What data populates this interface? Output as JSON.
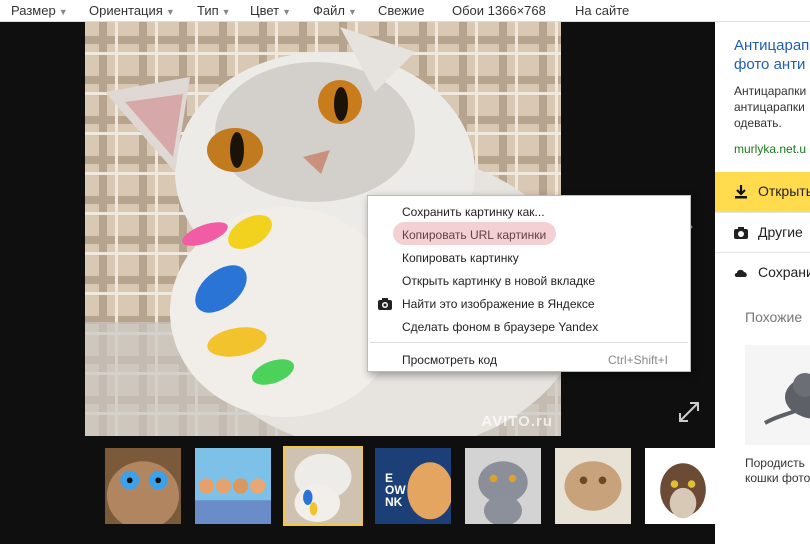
{
  "filters": [
    {
      "label": "Размер",
      "dropdown": true
    },
    {
      "label": "Ориентация",
      "dropdown": true
    },
    {
      "label": "Тип",
      "dropdown": true
    },
    {
      "label": "Цвет",
      "dropdown": true
    },
    {
      "label": "Файл",
      "dropdown": true
    },
    {
      "label": "Свежие",
      "dropdown": false
    },
    {
      "label": "Обои 1366×768",
      "dropdown": false
    },
    {
      "label": "На сайте",
      "dropdown": false
    }
  ],
  "viewer": {
    "watermark": "AVITO.ru"
  },
  "context_menu": {
    "items": [
      {
        "label": "Сохранить картинку как...",
        "icon": ""
      },
      {
        "label": "Копировать URL картинки",
        "icon": "",
        "highlighted": true
      },
      {
        "label": "Копировать картинку",
        "icon": ""
      },
      {
        "label": "Открыть картинку в новой вкладке",
        "icon": ""
      },
      {
        "label": "Найти это изображение в Яндексе",
        "icon": "camera-search-icon"
      },
      {
        "label": "Сделать фоном в браузере Yandex",
        "icon": ""
      },
      {
        "label": "Просмотреть код",
        "icon": "",
        "shortcut": "Ctrl+Shift+I"
      }
    ]
  },
  "thumbnails": [
    {
      "name": "blue-eyed-kitten",
      "label": ""
    },
    {
      "name": "kittens-row",
      "label": ""
    },
    {
      "name": "cat-colored-claws",
      "label": "",
      "active": true
    },
    {
      "name": "kitten-bow",
      "label": "E\nOW\nNK"
    },
    {
      "name": "grey-british-cat",
      "label": ""
    },
    {
      "name": "cat-with-toy",
      "label": ""
    },
    {
      "name": "siamese-cat",
      "label": ""
    }
  ],
  "sidepanel": {
    "ad_title_line1": "Антицарапки",
    "ad_title_line2": "фото анти",
    "ad_text_line1": "Антицарапки",
    "ad_text_line2": "антицарапки",
    "ad_text_line3": "одевать.",
    "ad_url": "murlyka.net.u",
    "open_button": "Открыть",
    "other_sizes_button": "Другие",
    "save_button": "Сохранить",
    "similar_title": "Похожие",
    "similar_caption_line1": "Породисть",
    "similar_caption_line2": "кошки фото"
  },
  "colors": {
    "accent_yellow": "#ffdb4d",
    "link_blue": "#1f5fb5",
    "url_green": "#1a7a1a",
    "viewer_bg": "#0f0f0f"
  }
}
